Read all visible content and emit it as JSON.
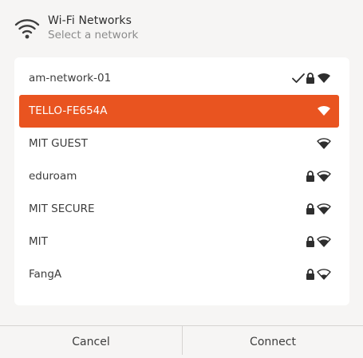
{
  "header": {
    "icon": "wifi-icon",
    "title": "Wi-Fi Networks",
    "subtitle": "Select a network"
  },
  "networks": [
    {
      "name": "am-network-01",
      "connected": true,
      "secured": true,
      "signal": "full",
      "selected": false
    },
    {
      "name": "TELLO-FE654A",
      "connected": false,
      "secured": false,
      "signal": "full",
      "selected": true
    },
    {
      "name": "MIT GUEST",
      "connected": false,
      "secured": false,
      "signal": "good",
      "selected": false
    },
    {
      "name": "eduroam",
      "connected": false,
      "secured": true,
      "signal": "good",
      "selected": false
    },
    {
      "name": "MIT SECURE",
      "connected": false,
      "secured": true,
      "signal": "good",
      "selected": false
    },
    {
      "name": "MIT",
      "connected": false,
      "secured": true,
      "signal": "good",
      "selected": false
    },
    {
      "name": "FangA",
      "connected": false,
      "secured": true,
      "signal": "weak",
      "selected": false
    }
  ],
  "buttons": {
    "cancel_label": "Cancel",
    "connect_label": "Connect"
  },
  "colors": {
    "accent": "#e95420",
    "background": "#f6f5f4",
    "panel": "#ffffff",
    "text": "#3d3d3d",
    "subtext": "#8b8b8b"
  }
}
